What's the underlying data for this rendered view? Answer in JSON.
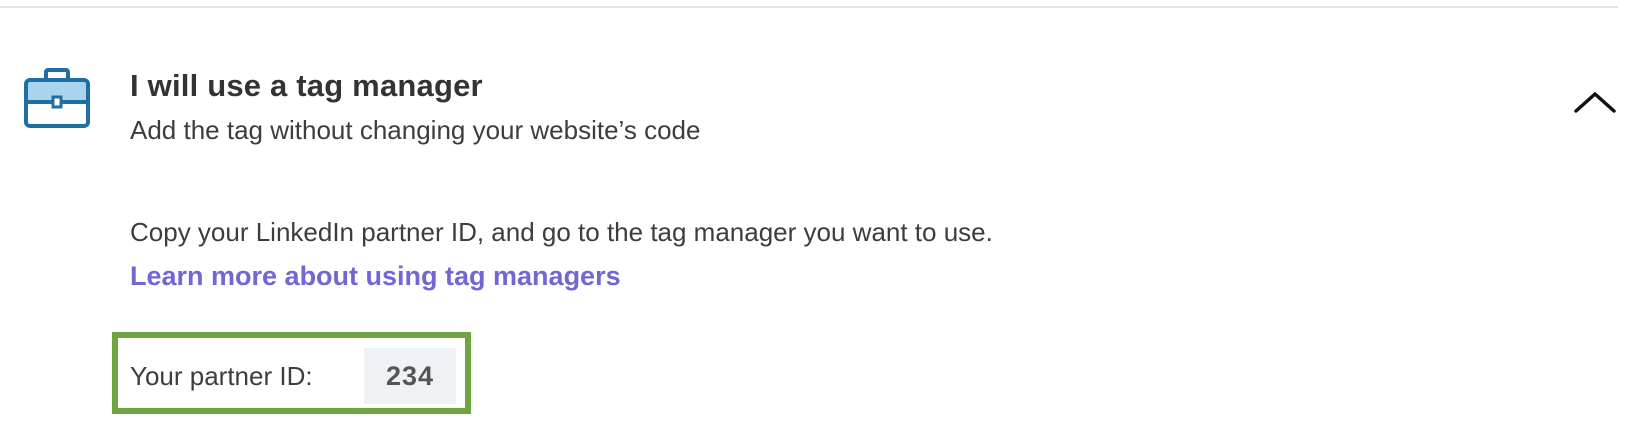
{
  "option": {
    "title": "I will use a tag manager",
    "subtitle": "Add the tag without changing your website’s code",
    "icon": "briefcase-icon",
    "expanded": true,
    "toggle_icon": "chevron-up-icon"
  },
  "content": {
    "instruction": "Copy your LinkedIn partner ID, and go to the tag manager you want to use.",
    "link_label": "Learn more about using tag managers"
  },
  "partner": {
    "label": "Your partner ID:",
    "value": "234"
  },
  "colors": {
    "icon_blue": "#1f6fa3",
    "icon_fill": "#a9d3ef",
    "link": "#7266d6",
    "highlight_border": "#6ea540",
    "id_background": "#eef2f5"
  }
}
